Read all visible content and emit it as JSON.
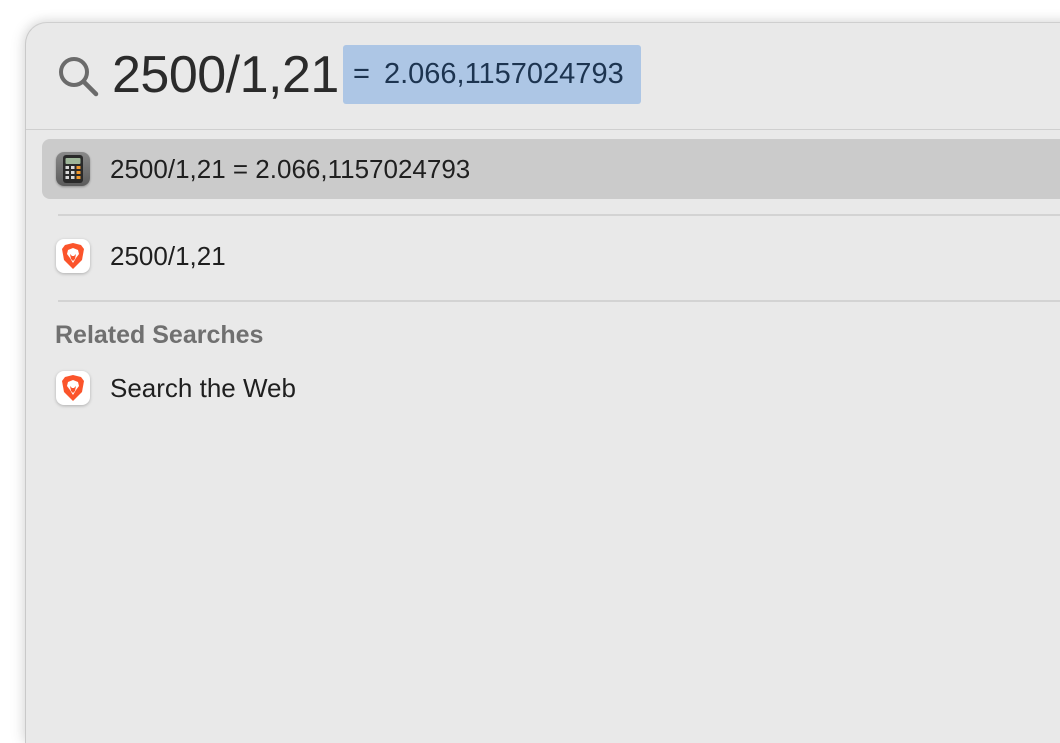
{
  "search": {
    "query": "2500/1,21",
    "inline_equals": "=",
    "inline_result": "2.066,1157024793"
  },
  "results": [
    {
      "label": "2500/1,21 = 2.066,1157024793",
      "icon": "calculator-icon",
      "selected": true
    },
    {
      "label": "2500/1,21",
      "icon": "brave-browser-icon",
      "selected": false
    }
  ],
  "related": {
    "title": "Related Searches",
    "items": [
      {
        "label": "Search the Web",
        "icon": "brave-browser-icon"
      }
    ]
  },
  "colors": {
    "panel_bg": "#e9e9e9",
    "selection_highlight": "#adc6e5",
    "selected_row": "#cbcbcb",
    "brave_orange": "#fb542b"
  }
}
